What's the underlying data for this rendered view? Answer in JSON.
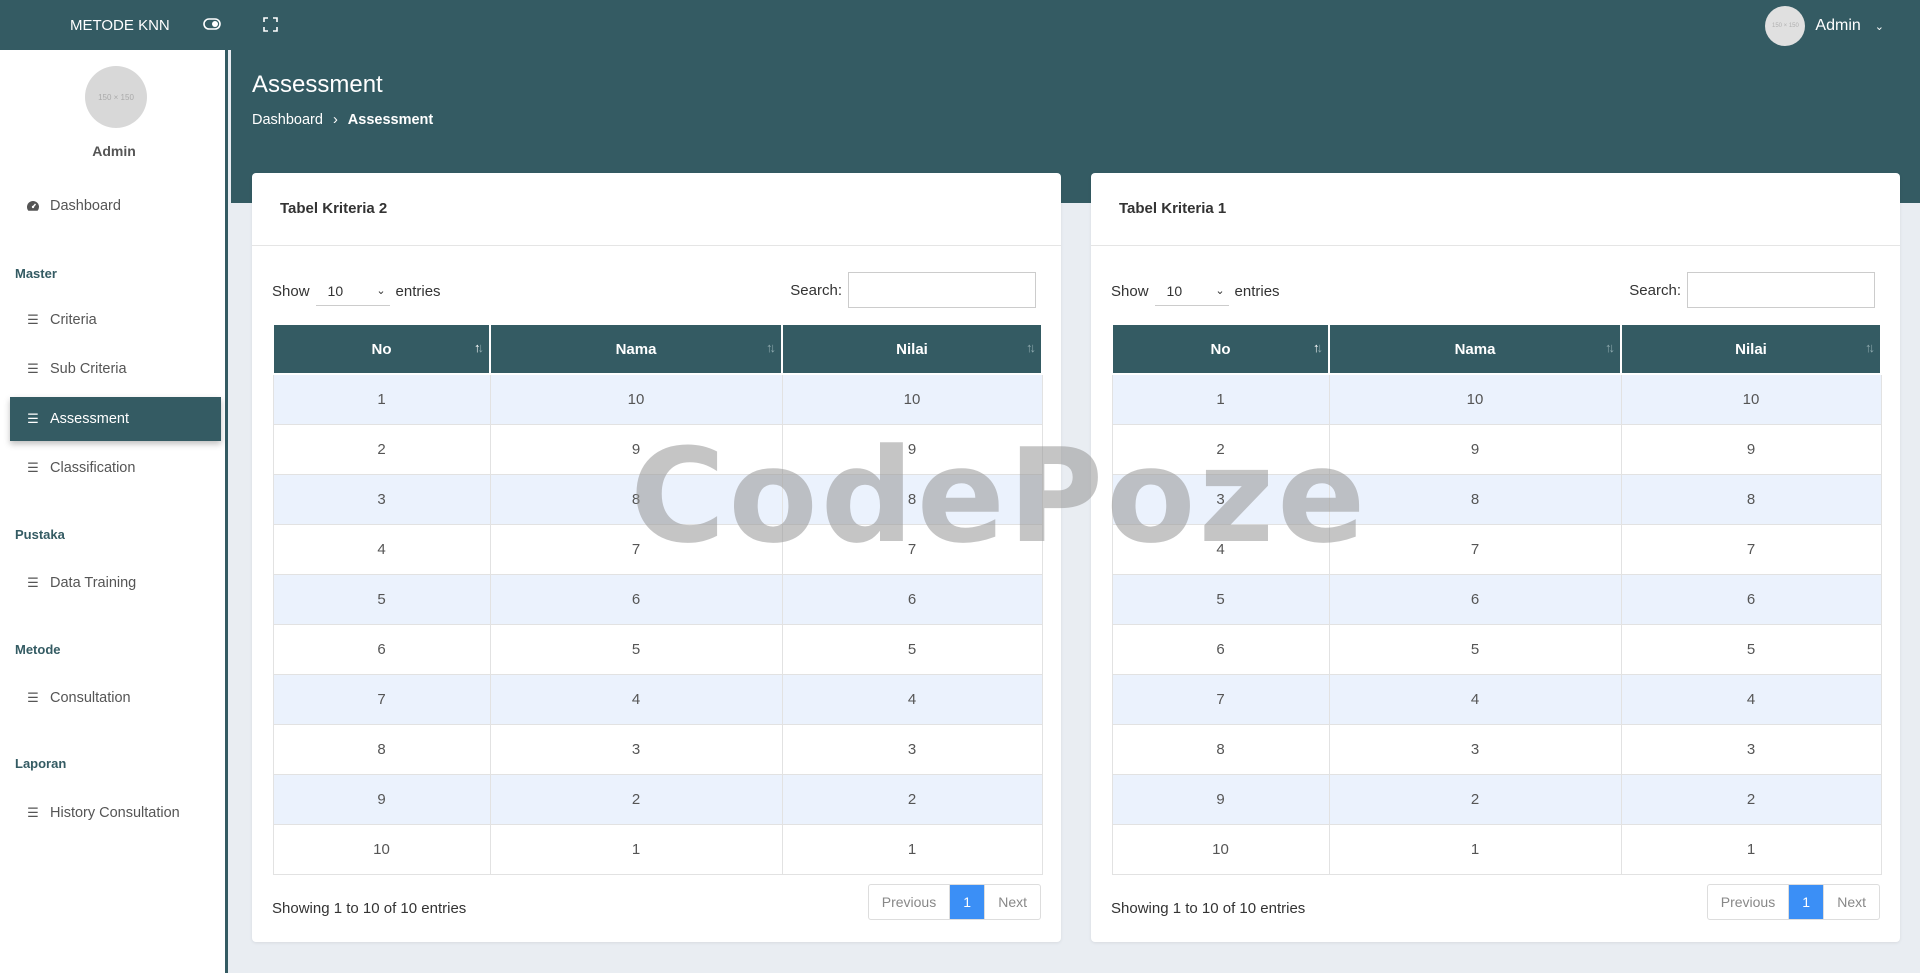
{
  "topbar": {
    "brand": "METODE KNN",
    "user_name": "Admin",
    "avatar_text": "150 × 150",
    "icons": [
      "toggle-icon",
      "fullscreen-icon",
      "chevron-down-icon"
    ]
  },
  "sidebar": {
    "avatar_text": "150 × 150",
    "user_name": "Admin",
    "items": [
      {
        "label": "Dashboard",
        "icon": "dashboard-icon"
      },
      {
        "label": "Criteria",
        "icon": "list-icon"
      },
      {
        "label": "Sub Criteria",
        "icon": "list-icon"
      },
      {
        "label": "Assessment",
        "icon": "list-icon",
        "active": true
      },
      {
        "label": "Classification",
        "icon": "list-icon"
      },
      {
        "label": "Data Training",
        "icon": "list-icon"
      },
      {
        "label": "Consultation",
        "icon": "list-icon"
      },
      {
        "label": "History Consultation",
        "icon": "list-icon"
      }
    ],
    "sections": [
      "Master",
      "Pustaka",
      "Metode",
      "Laporan"
    ]
  },
  "header": {
    "title": "Assessment",
    "breadcrumb": [
      "Dashboard",
      "Assessment"
    ]
  },
  "cards": [
    {
      "title": "Tabel Kriteria 2",
      "show_label": "Show",
      "entries_value": "10",
      "entries_label": "entries",
      "search_label": "Search:",
      "columns": [
        "No",
        "Nama",
        "Nilai"
      ],
      "rows": [
        [
          "1",
          "10",
          "10"
        ],
        [
          "2",
          "9",
          "9"
        ],
        [
          "3",
          "8",
          "8"
        ],
        [
          "4",
          "7",
          "7"
        ],
        [
          "5",
          "6",
          "6"
        ],
        [
          "6",
          "5",
          "5"
        ],
        [
          "7",
          "4",
          "4"
        ],
        [
          "8",
          "3",
          "3"
        ],
        [
          "9",
          "2",
          "2"
        ],
        [
          "10",
          "1",
          "1"
        ]
      ],
      "info": "Showing 1 to 10 of 10 entries",
      "pager": {
        "previous": "Previous",
        "current": "1",
        "next": "Next"
      }
    },
    {
      "title": "Tabel Kriteria 1",
      "show_label": "Show",
      "entries_value": "10",
      "entries_label": "entries",
      "search_label": "Search:",
      "columns": [
        "No",
        "Nama",
        "Nilai"
      ],
      "rows": [
        [
          "1",
          "10",
          "10"
        ],
        [
          "2",
          "9",
          "9"
        ],
        [
          "3",
          "8",
          "8"
        ],
        [
          "4",
          "7",
          "7"
        ],
        [
          "5",
          "6",
          "6"
        ],
        [
          "6",
          "5",
          "5"
        ],
        [
          "7",
          "4",
          "4"
        ],
        [
          "8",
          "3",
          "3"
        ],
        [
          "9",
          "2",
          "2"
        ],
        [
          "10",
          "1",
          "1"
        ]
      ],
      "info": "Showing 1 to 10 of 10 entries",
      "pager": {
        "previous": "Previous",
        "current": "1",
        "next": "Next"
      }
    }
  ],
  "watermark": "CodePoze",
  "colors": {
    "primary": "#345b63",
    "accent": "#3b8ff6",
    "row_stripe": "#ebf2fd",
    "background": "#e9edf2"
  }
}
